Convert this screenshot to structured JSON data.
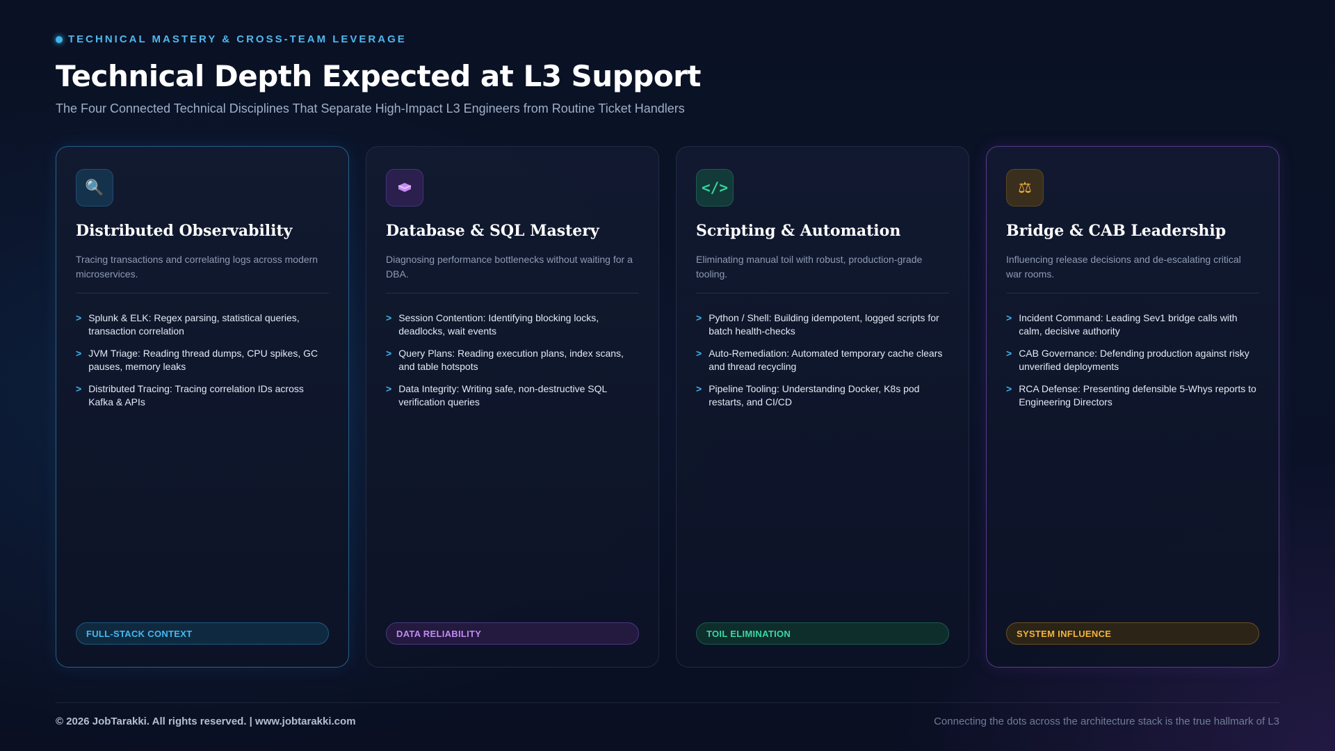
{
  "header": {
    "eyebrow": "TECHNICAL MASTERY & CROSS-TEAM LEVERAGE",
    "title": "Technical Depth Expected at L3 Support",
    "subtitle": "The Four Connected Technical Disciplines That Separate High-Impact L3 Engineers from Routine Ticket Handlers"
  },
  "colors": {
    "accent_blue": "#3fb4ec",
    "accent_purple": "#c08af5",
    "accent_green": "#3ad9a4",
    "accent_amber": "#f3b43e"
  },
  "cards": [
    {
      "icon": "magnifier-icon",
      "glyph": "🔍",
      "title": "Distributed Observability",
      "description": "Tracing transactions and correlating logs across modern microservices.",
      "points": [
        "Splunk & ELK: Regex parsing, statistical queries, transaction correlation",
        "JVM Triage: Reading thread dumps, CPU spikes, GC pauses, memory leaks",
        "Distributed Tracing: Tracing correlation IDs across Kafka & APIs"
      ],
      "tag": "FULL-STACK CONTEXT"
    },
    {
      "icon": "database-icon",
      "glyph": "🛢",
      "title": "Database & SQL Mastery",
      "description": "Diagnosing performance bottlenecks without waiting for a DBA.",
      "points": [
        "Session Contention: Identifying blocking locks, deadlocks, wait events",
        "Query Plans: Reading execution plans, index scans, and table hotspots",
        "Data Integrity: Writing safe, non-destructive SQL verification queries"
      ],
      "tag": "DATA RELIABILITY"
    },
    {
      "icon": "code-icon",
      "glyph": "</>",
      "title": "Scripting & Automation",
      "description": "Eliminating manual toil with robust, production-grade tooling.",
      "points": [
        "Python / Shell: Building idempotent, logged scripts for batch health-checks",
        "Auto-Remediation: Automated temporary cache clears and thread recycling",
        "Pipeline Tooling: Understanding Docker, K8s pod restarts, and CI/CD"
      ],
      "tag": "TOIL ELIMINATION"
    },
    {
      "icon": "scales-icon",
      "glyph": "⚖",
      "title": "Bridge & CAB Leadership",
      "description": "Influencing release decisions and de-escalating critical war rooms.",
      "points": [
        "Incident Command: Leading Sev1 bridge calls with calm, decisive authority",
        "CAB Governance: Defending production against risky unverified deployments",
        "RCA Defense: Presenting defensible 5-Whys reports to Engineering Directors"
      ],
      "tag": "SYSTEM INFLUENCE"
    }
  ],
  "footer": {
    "copyright": "© 2026 JobTarakki. All rights reserved.  |  www.jobtarakki.com",
    "tagline": "Connecting the dots across the architecture stack is the true hallmark of L3"
  }
}
